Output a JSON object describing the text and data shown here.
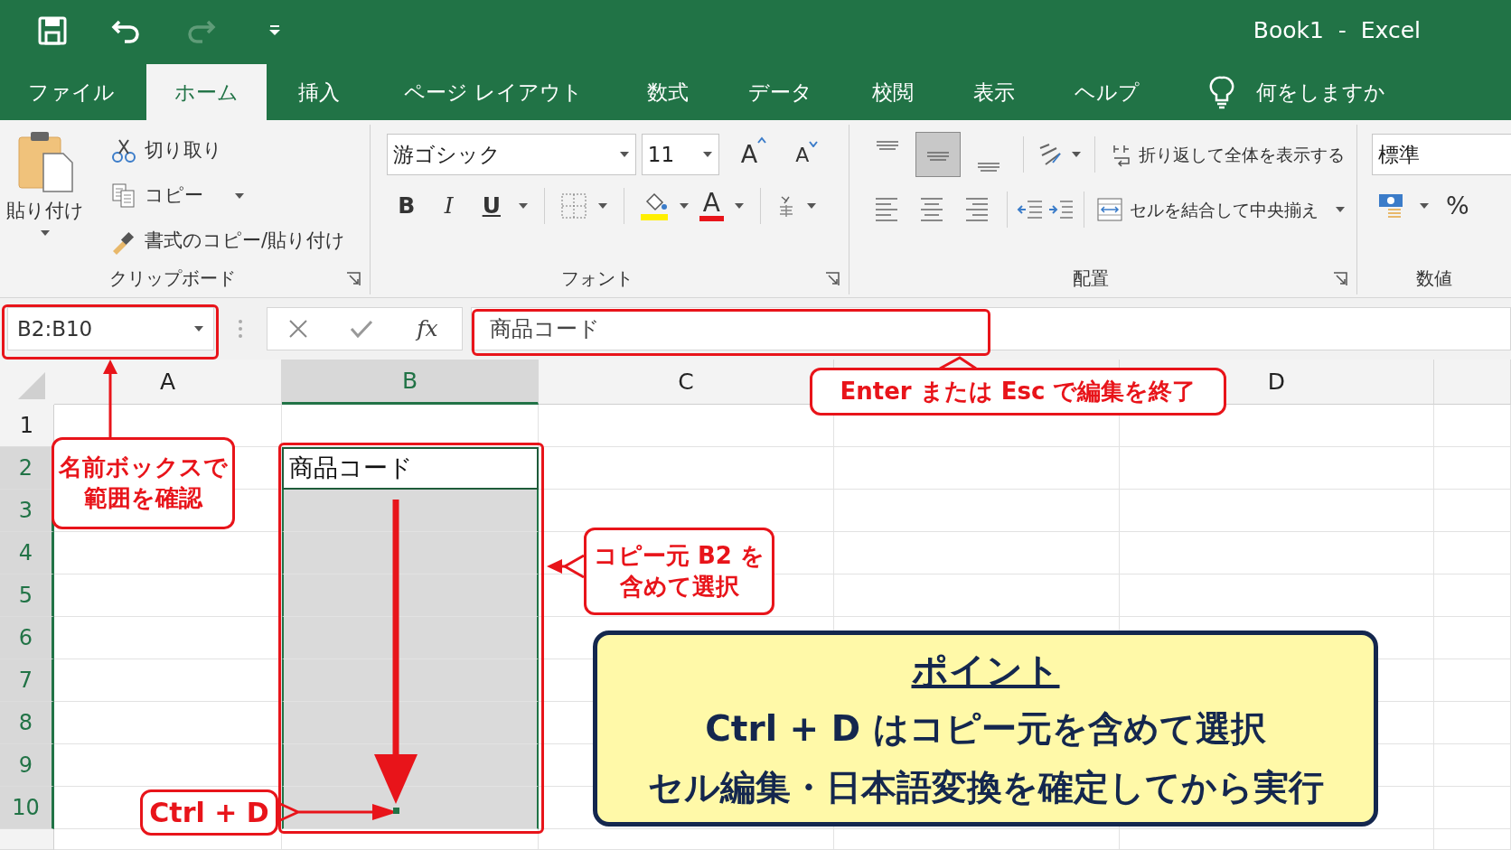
{
  "quick_access": [
    {
      "kind": "save",
      "disabled": false
    },
    {
      "kind": "undo",
      "disabled": false
    },
    {
      "kind": "redo",
      "disabled": true
    },
    {
      "kind": "customize",
      "disabled": false
    }
  ],
  "window": {
    "title": "Book1  -  Excel"
  },
  "tabs": [
    {
      "label": "ファイル",
      "selected": false
    },
    {
      "label": "ホーム",
      "selected": true
    },
    {
      "label": "挿入",
      "selected": false
    },
    {
      "label": "ページ レイアウト",
      "selected": false
    },
    {
      "label": "数式",
      "selected": false
    },
    {
      "label": "データ",
      "selected": false
    },
    {
      "label": "校閲",
      "selected": false
    },
    {
      "label": "表示",
      "selected": false
    },
    {
      "label": "ヘルプ",
      "selected": false
    }
  ],
  "tell_me": {
    "placeholder": "何をしますか"
  },
  "ribbon": {
    "clipboard": {
      "label": "クリップボード",
      "paste": "貼り付け",
      "commands": [
        {
          "kind": "cut",
          "label": "切り取り",
          "dropdown": false
        },
        {
          "kind": "copy",
          "label": "コピー",
          "dropdown": true
        },
        {
          "kind": "format_painter",
          "label": "書式のコピー/貼り付け",
          "dropdown": false
        }
      ]
    },
    "font": {
      "label": "フォント",
      "font_name": "游ゴシック",
      "font_size": "11",
      "grow": "A",
      "shrink": "A",
      "styles": [
        {
          "kind": "bold",
          "label": "B"
        },
        {
          "kind": "italic",
          "label": "I"
        },
        {
          "kind": "underline",
          "label": "U"
        }
      ],
      "font_color": "A"
    },
    "alignment": {
      "label": "配置",
      "vertical": [
        {
          "kind": "top",
          "selected": false
        },
        {
          "kind": "middle",
          "selected": true
        },
        {
          "kind": "bottom",
          "selected": false
        }
      ],
      "horizontal": [
        {
          "kind": "left",
          "selected": false
        },
        {
          "kind": "center",
          "selected": false
        },
        {
          "kind": "right",
          "selected": false
        }
      ],
      "wrap_text": "折り返して全体を表示する",
      "merge": "セルを結合して中央揃え"
    },
    "number": {
      "label": "数値",
      "format": "標準",
      "percent": "%"
    }
  },
  "formula_bar": {
    "name_box": "B2:B10",
    "function_label": "fx",
    "value": "商品コード"
  },
  "sheet": {
    "columns": [
      {
        "label": "A",
        "selected": false
      },
      {
        "label": "B",
        "selected": true
      },
      {
        "label": "C",
        "selected": false
      },
      {
        "selected": false
      },
      {
        "label": "D",
        "selected": false
      }
    ],
    "rows": [
      {
        "header": "1",
        "selected": false
      },
      {
        "header": "2",
        "selected": true,
        "cells": [
          {},
          {
            "value": "商品コード",
            "active": true
          },
          {},
          {},
          {}
        ]
      },
      {
        "header": "3",
        "selected": true
      },
      {
        "header": "4",
        "selected": true
      },
      {
        "header": "5",
        "selected": true
      },
      {
        "header": "6",
        "selected": true
      },
      {
        "header": "7",
        "selected": true
      },
      {
        "header": "8",
        "selected": true
      },
      {
        "header": "9",
        "selected": true
      },
      {
        "header": "10",
        "selected": true
      }
    ]
  },
  "callouts": [
    {
      "kind": "name_box_note",
      "text": "名前ボックスで範囲を確認"
    },
    {
      "kind": "edit_note",
      "text": "Enter または Esc で編集を終了"
    },
    {
      "kind": "range_note",
      "text": "コピー元 B2 を含めて選択"
    },
    {
      "kind": "shortcut_note",
      "text": "Ctrl  +  D"
    }
  ],
  "point_box": {
    "title": "ポイント",
    "lines": [
      "Ctrl + D はコピー元を含めて選択",
      "セル編集・日本語変換を確定してから実行"
    ]
  }
}
